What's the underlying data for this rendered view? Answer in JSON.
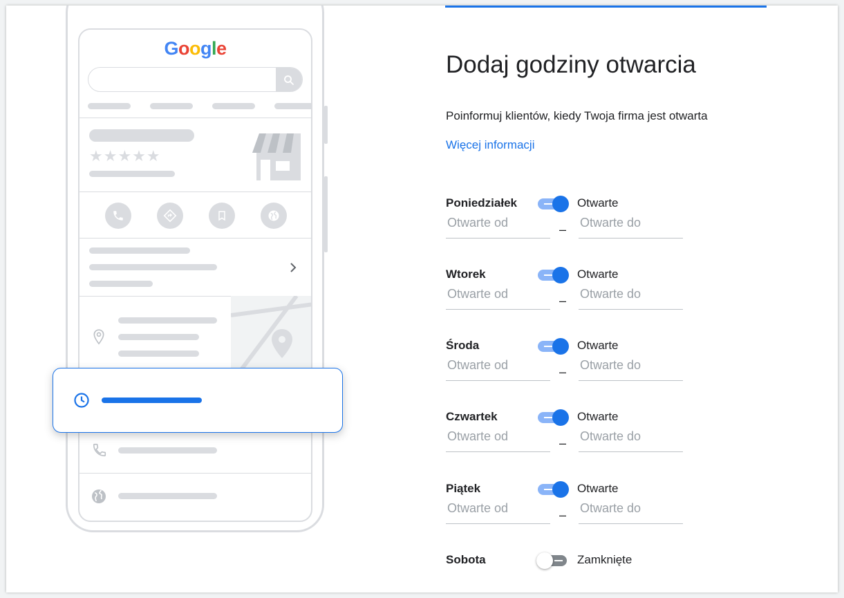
{
  "illustration": {
    "logo_letters": [
      {
        "ch": "G",
        "color": "#4285F4"
      },
      {
        "ch": "o",
        "color": "#EA4335"
      },
      {
        "ch": "o",
        "color": "#FBBC05"
      },
      {
        "ch": "g",
        "color": "#4285F4"
      },
      {
        "ch": "l",
        "color": "#34A853"
      },
      {
        "ch": "e",
        "color": "#EA4335"
      }
    ],
    "stars": "★★★★★"
  },
  "form": {
    "title": "Dodaj godziny otwarcia",
    "subtitle": "Poinformuj klientów, kiedy Twoja firma jest otwarta",
    "more_info_link": "Więcej informacji",
    "separator": "–",
    "days": [
      {
        "name": "Poniedziałek",
        "status": "Otwarte",
        "is_open": true,
        "from_placeholder": "Otwarte od",
        "to_placeholder": "Otwarte do"
      },
      {
        "name": "Wtorek",
        "status": "Otwarte",
        "is_open": true,
        "from_placeholder": "Otwarte od",
        "to_placeholder": "Otwarte do"
      },
      {
        "name": "Środa",
        "status": "Otwarte",
        "is_open": true,
        "from_placeholder": "Otwarte od",
        "to_placeholder": "Otwarte do"
      },
      {
        "name": "Czwartek",
        "status": "Otwarte",
        "is_open": true,
        "from_placeholder": "Otwarte od",
        "to_placeholder": "Otwarte do"
      },
      {
        "name": "Piątek",
        "status": "Otwarte",
        "is_open": true,
        "from_placeholder": "Otwarte od",
        "to_placeholder": "Otwarte do"
      },
      {
        "name": "Sobota",
        "status": "Zamknięte",
        "is_open": false
      }
    ]
  },
  "colors": {
    "accent": "#1a73e8",
    "placeholder_gray": "#dadce0"
  }
}
